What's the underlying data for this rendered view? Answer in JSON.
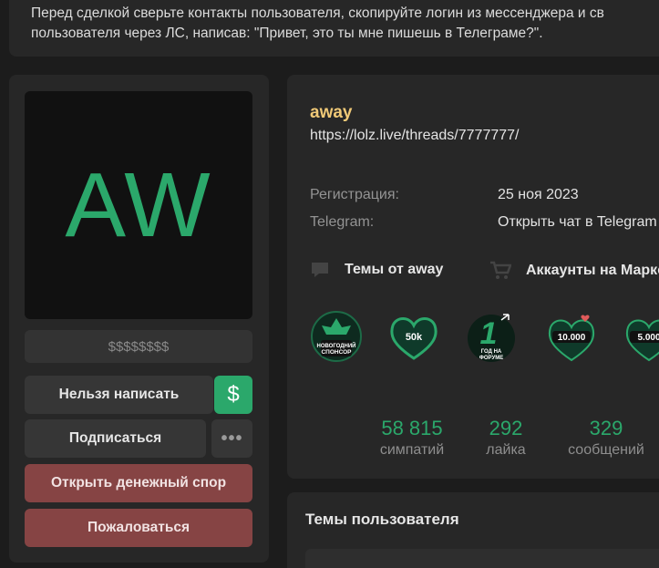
{
  "notice": {
    "line1": "Перед сделкой сверьте контакты пользователя, скопируйте логин из мессенджера и св",
    "line2": "пользователя через ЛС, написав: \"Привет, это ты мне пишешь в Телеграме?\"."
  },
  "profile": {
    "avatar_text": "AW",
    "price": "$$$$$$$$",
    "buttons": {
      "cannot_write": "Нельзя написать",
      "dollar": "$",
      "subscribe": "Подписаться",
      "more": "•••",
      "open_dispute": "Открыть денежный спор",
      "report": "Пожаловаться"
    }
  },
  "user": {
    "name": "away",
    "link": "https://lolz.live/threads/7777777/",
    "info": [
      {
        "label": "Регистрация:",
        "value": "25 ноя 2023"
      },
      {
        "label": "Telegram:",
        "value": "Открыть чат в Telegram"
      }
    ],
    "links": {
      "threads": "Темы от away",
      "accounts": "Аккаунты на Маркете"
    },
    "trophies": [
      {
        "icon": "sponsor-trophy-icon",
        "text": "НОВОГОДНИЙ СПОНСОР"
      },
      {
        "icon": "50k-sympathy-trophy-icon",
        "text": "50k"
      },
      {
        "icon": "one-year-trophy-icon",
        "text": "ГОД НА ФОРУМЕ"
      },
      {
        "icon": "10000-trophy-icon",
        "text": "10.000"
      },
      {
        "icon": "5000-trophy-icon",
        "text": "5.00"
      }
    ],
    "stats": [
      {
        "value": "58 815",
        "label": "симпатий"
      },
      {
        "value": "292",
        "label": "лайка"
      },
      {
        "value": "329",
        "label": "сообщений"
      }
    ]
  },
  "threads_section": {
    "title": "Темы пользователя"
  },
  "colors": {
    "accent": "#2ba86b",
    "username": "#f0c977",
    "danger": "#864444"
  }
}
